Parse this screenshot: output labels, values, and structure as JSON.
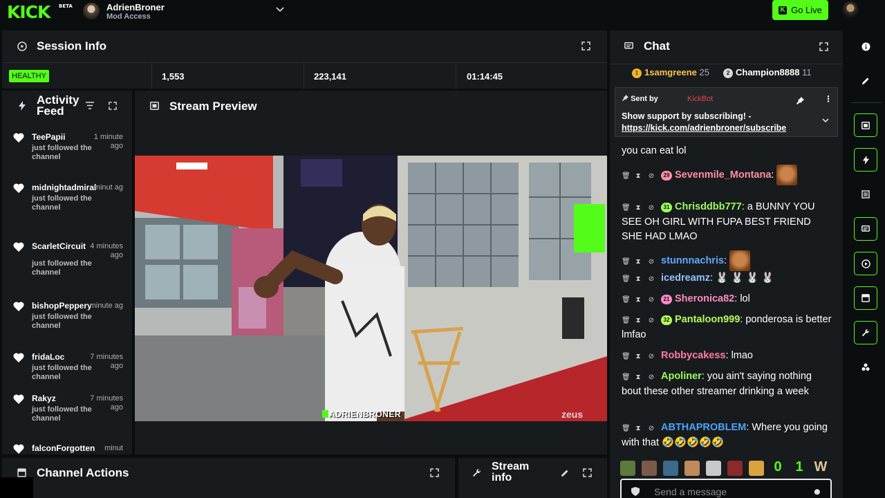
{
  "topbar": {
    "logo": "KICK",
    "logo_badge": "BETA",
    "channel_name": "AdrienBroner",
    "channel_role": "Mod Access",
    "go_live_label": "Go Live"
  },
  "session": {
    "title": "Session Info",
    "health": "HEALTHY",
    "viewers": "1,553",
    "followers": "223,141",
    "uptime": "01:14:45"
  },
  "activity": {
    "title": "Activity Feed",
    "items": [
      {
        "user": "TeePapii",
        "time": "1 minute ago",
        "desc": "just followed the channel"
      },
      {
        "user": "midnightadmiral",
        "time": "minut ag",
        "desc": "just followed the channel"
      },
      {
        "user": "ScarletCircuit",
        "time": "4 minutes ago",
        "desc": "just followed the channel"
      },
      {
        "user": "bishopPeppery",
        "time": "minute ag",
        "desc": "just followed the channel"
      },
      {
        "user": "fridaLoc",
        "time": "7 minutes ago",
        "desc": "just followed the channel"
      },
      {
        "user": "Rakyz",
        "time": "7 minutes ago",
        "desc": "just followed the channel"
      },
      {
        "user": "falconForgotten",
        "time": "minut",
        "desc": ""
      }
    ]
  },
  "preview": {
    "title": "Stream Preview",
    "overlay_name": "ADRIENBRONER",
    "overlay_brand": "zeus"
  },
  "actions": {
    "title": "Channel Actions"
  },
  "streaminfo": {
    "title": "Stream info"
  },
  "chat": {
    "title": "Chat",
    "leaderboard": [
      {
        "rank": "1",
        "name": "1samgreene",
        "count": "25"
      },
      {
        "rank": "2",
        "name": "Champion8888",
        "count": "11"
      }
    ],
    "pinned": {
      "sent_by_label": "Sent by",
      "sender": "KickBot",
      "text": "Show support by subscribing! -",
      "link": "https://kick.com/adrienbroner/subscribe"
    },
    "partial_message": "you can eat lol",
    "messages": [
      {
        "badge": "29",
        "user": "Sevenmile_Montana",
        "color": "#ff8fa3",
        "text": ""
      },
      {
        "badge": "31",
        "user": "Chrisddbb777",
        "color": "#9afc5e",
        "text": "a BUNNY YOU SEE OH GIRL WITH FUPA BEST FRIEND SHE HAD LMAO"
      },
      {
        "badge": "",
        "user": "stunnnachris",
        "color": "#5fa8ff",
        "text": ""
      },
      {
        "badge": "",
        "user": "icedreamz",
        "color": "#8fc1ff",
        "text": "🐰 🐰 🐰 🐰"
      },
      {
        "badge": "21",
        "user": "Sheronica82",
        "color": "#ff8ac8",
        "text": "lol"
      },
      {
        "badge": "32",
        "user": "Pantaloon999",
        "color": "#b5fc5a",
        "text": "ponderosa is better lmfao"
      },
      {
        "badge": "",
        "user": "Robbycakess",
        "color": "#ff7aa8",
        "text": "lmao"
      },
      {
        "badge": "",
        "user": "Apoliner",
        "color": "#9afc5e",
        "text": "you ain't saying nothing bout these other streamer drinking a week"
      },
      {
        "badge": "",
        "user": "ABTHAPROBLEM",
        "color": "#4aa3ff",
        "text": "Where you going with that 🤣🤣🤣🤣🤣"
      }
    ],
    "emote_bar": [
      "0",
      "1",
      "W"
    ],
    "input_placeholder": "Send a message"
  },
  "colors": {
    "accent": "#53fc18",
    "panel": "#181b1d",
    "background": "#0b0e0f"
  }
}
